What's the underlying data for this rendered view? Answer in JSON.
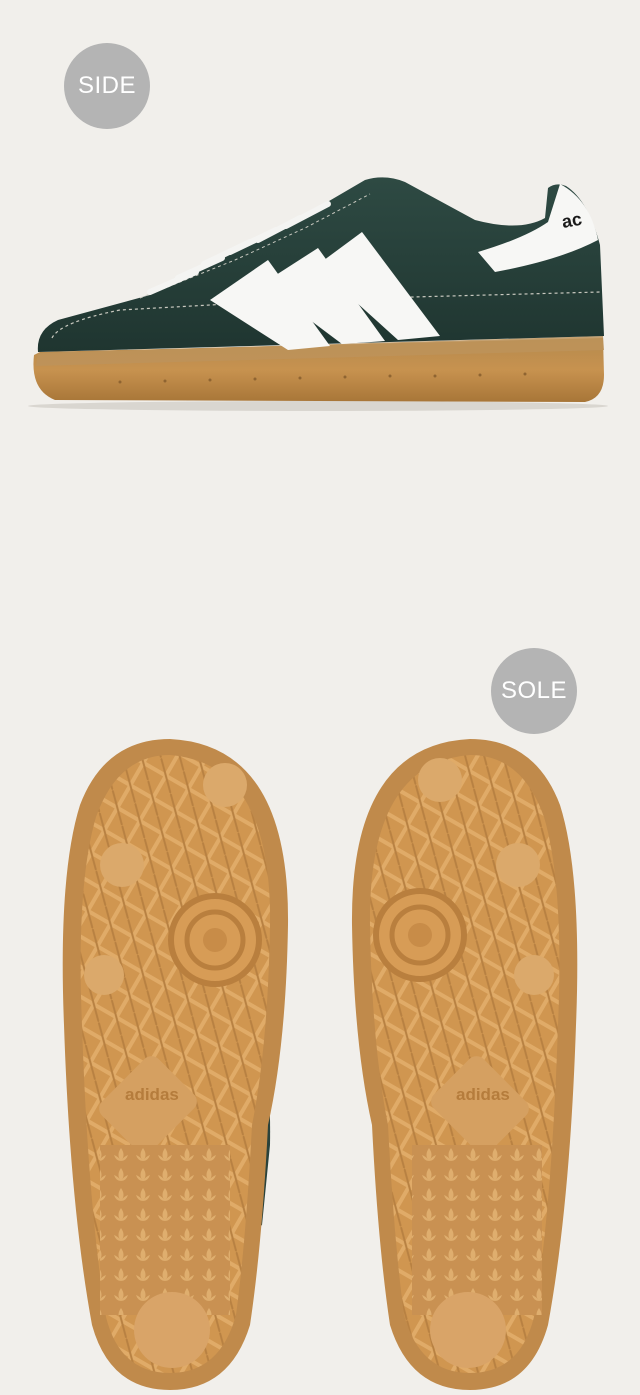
{
  "badges": {
    "side": "SIDE",
    "sole": "SOLE"
  },
  "product": {
    "tongue_logo_text": "ac",
    "sole_logo_text": "adidas"
  },
  "colors": {
    "background": "#f1efeb",
    "badge": "#b4b4b4",
    "upper_green": "#27413a",
    "stripe_white": "#f7f7f5",
    "gum_sole": "#c99552",
    "gum_sole_dark": "#a9763c"
  },
  "icons": [
    "shoe-side-view",
    "sole-tread-pattern",
    "adidas-trefoil-icon"
  ]
}
